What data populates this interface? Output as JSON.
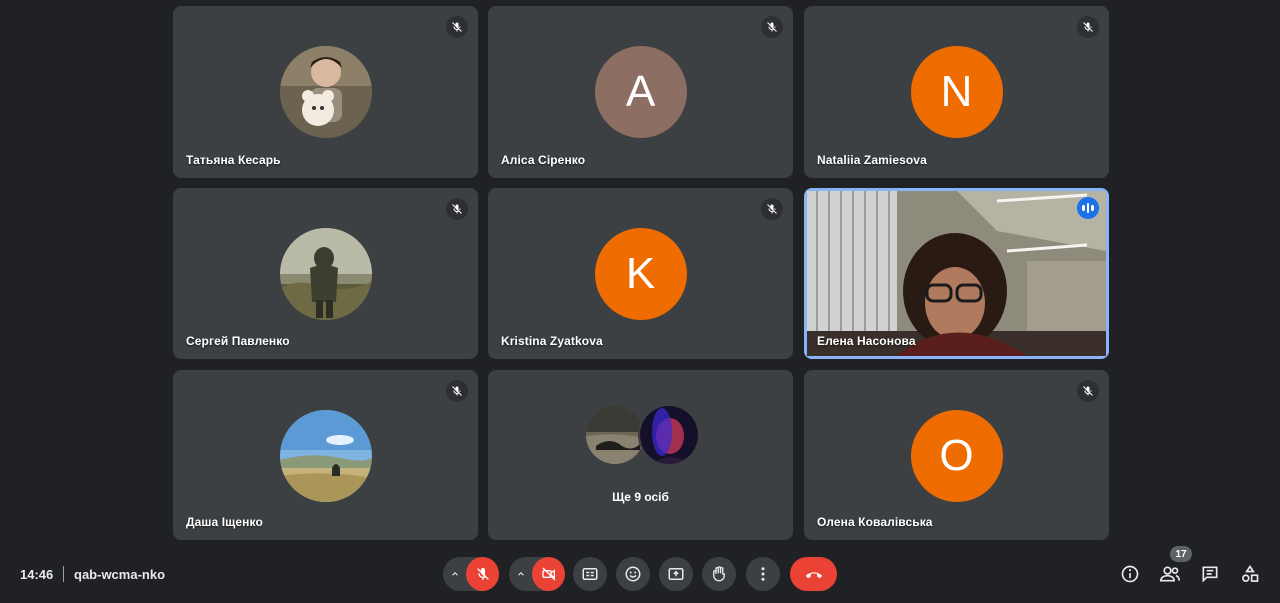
{
  "meeting": {
    "time": "14:46",
    "code": "qab-wcma-nko"
  },
  "participants": [
    {
      "name": "Татьяна Кесарь",
      "avatar_type": "photo",
      "muted": true
    },
    {
      "name": "Аліса Сіренко",
      "avatar_type": "letter",
      "letter": "A",
      "avatar_color": "#8d6e63",
      "muted": true
    },
    {
      "name": "Nataliia Zamiesova",
      "avatar_type": "letter",
      "letter": "N",
      "avatar_color": "#ef6c00",
      "muted": true
    },
    {
      "name": "Сергей Павленко",
      "avatar_type": "photo",
      "muted": true
    },
    {
      "name": "Kristina Zyatkova",
      "avatar_type": "letter",
      "letter": "K",
      "avatar_color": "#ef6c00",
      "muted": true
    },
    {
      "name": "Елена Насонова",
      "avatar_type": "video",
      "muted": false,
      "speaking": true
    },
    {
      "name": "Даша Іщенко",
      "avatar_type": "photo",
      "muted": true
    },
    {
      "name": "Олена Ковалівська",
      "avatar_type": "letter",
      "letter": "O",
      "avatar_color": "#ef6c00",
      "muted": true
    }
  ],
  "more_tile": {
    "label": "Ще 9 осіб"
  },
  "people_count": "17",
  "colors": {
    "background": "#202124",
    "tile": "#3c4043",
    "accent_red": "#ea4335",
    "active_border": "#8ab4f8",
    "speaking_badge": "#1a73e8"
  },
  "controls": [
    {
      "icon": "mic-off-icon",
      "state": "off"
    },
    {
      "icon": "camera-off-icon",
      "state": "off"
    },
    {
      "icon": "captions-icon"
    },
    {
      "icon": "emoji-icon"
    },
    {
      "icon": "present-screen-icon"
    },
    {
      "icon": "raise-hand-icon"
    },
    {
      "icon": "more-options-icon"
    },
    {
      "icon": "end-call-icon"
    }
  ],
  "right_controls": [
    {
      "icon": "info-icon"
    },
    {
      "icon": "people-icon"
    },
    {
      "icon": "chat-icon"
    },
    {
      "icon": "activities-icon"
    }
  ]
}
